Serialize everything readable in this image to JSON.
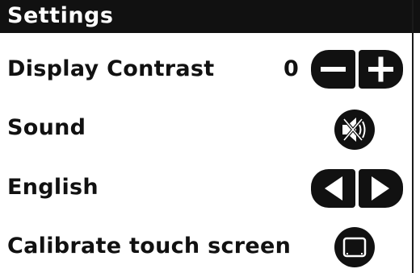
{
  "window": {
    "title": "Settings"
  },
  "settings": {
    "contrast": {
      "label": "Display Contrast",
      "value": "0",
      "decrease_icon": "minus-icon",
      "increase_icon": "plus-icon"
    },
    "sound": {
      "label": "Sound",
      "state": "muted",
      "icon": "speaker-muted-icon"
    },
    "language": {
      "label": "English",
      "prev_icon": "triangle-left-icon",
      "next_icon": "triangle-right-icon"
    },
    "calibrate": {
      "label": "Calibrate touch screen",
      "icon": "screen-icon"
    }
  },
  "colors": {
    "title_bar": "#111111",
    "title_text": "#ffffff",
    "background": "#ffffff",
    "text": "#111111",
    "button_fill": "#111111",
    "button_glyph": "#ffffff"
  }
}
